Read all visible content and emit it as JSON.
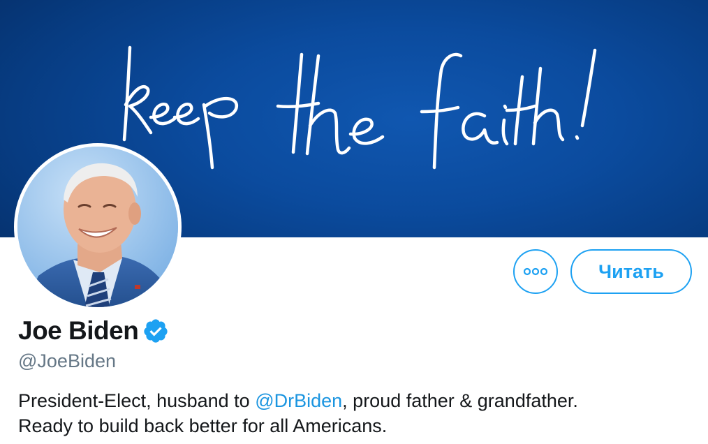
{
  "banner": {
    "script_text": "keep the faith!"
  },
  "profile": {
    "name": "Joe Biden",
    "handle": "@JoeBiden",
    "verified": true,
    "bio_before": "President-Elect, husband to ",
    "bio_mention": "@DrBiden",
    "bio_after": ", proud father & grandfather.",
    "bio_line2": "Ready to build back better for all Americans."
  },
  "actions": {
    "follow_label": "Читать",
    "more_icon": "more-dots-icon"
  },
  "icons": {
    "verified": "verified-badge-icon"
  },
  "colors": {
    "accent": "#1da1f2",
    "mention": "#1b95e0",
    "banner": "#0b4b9e",
    "text_primary": "#14171a",
    "text_secondary": "#657786"
  }
}
